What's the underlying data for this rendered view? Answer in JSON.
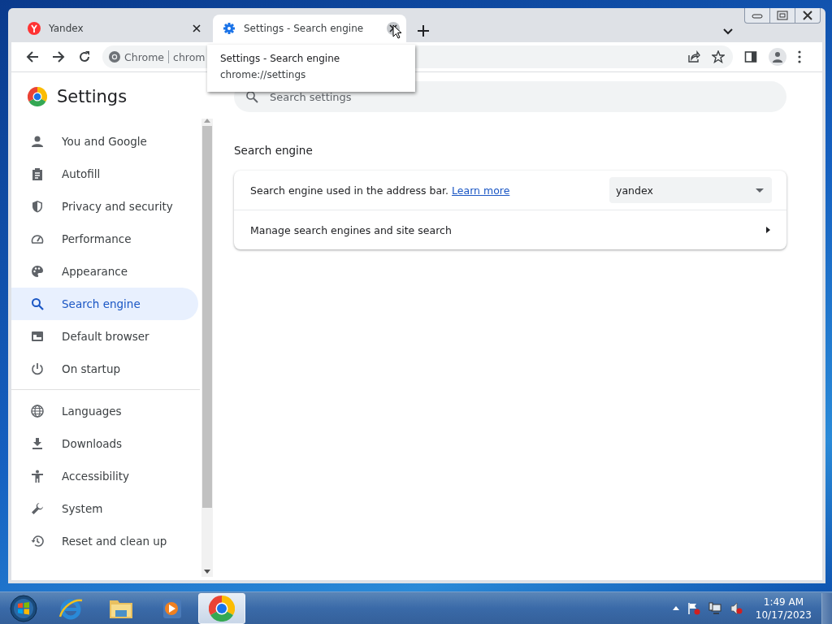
{
  "tabs": [
    {
      "title": "Yandex",
      "selected": false
    },
    {
      "title": "Settings - Search engine",
      "selected": true
    }
  ],
  "tooltip": {
    "title": "Settings - Search engine",
    "url": "chrome://settings"
  },
  "address_bar": {
    "chip": "Chrome",
    "text": "chrom"
  },
  "settings": {
    "title": "Settings",
    "search": {
      "placeholder": "Search settings"
    }
  },
  "sidebar": {
    "groups": [
      [
        {
          "label": "You and Google",
          "selected": false
        },
        {
          "label": "Autofill",
          "selected": false
        },
        {
          "label": "Privacy and security",
          "selected": false
        },
        {
          "label": "Performance",
          "selected": false
        },
        {
          "label": "Appearance",
          "selected": false
        },
        {
          "label": "Search engine",
          "selected": true
        },
        {
          "label": "Default browser",
          "selected": false
        },
        {
          "label": "On startup",
          "selected": false
        }
      ],
      [
        {
          "label": "Languages",
          "selected": false
        },
        {
          "label": "Downloads",
          "selected": false
        },
        {
          "label": "Accessibility",
          "selected": false
        },
        {
          "label": "System",
          "selected": false
        },
        {
          "label": "Reset and clean up",
          "selected": false
        }
      ]
    ]
  },
  "section": {
    "title": "Search engine",
    "rows": [
      {
        "kind": "select",
        "text": "Search engine used in the address bar.",
        "link": "Learn more",
        "value": "yandex"
      },
      {
        "kind": "nav",
        "text": "Manage search engines and site search"
      }
    ]
  },
  "taskbar": {
    "apps": [
      {
        "selected": false
      },
      {
        "selected": false
      },
      {
        "selected": false
      },
      {
        "selected": true
      }
    ],
    "clock": {
      "time": "1:49 AM",
      "date": "10/17/2023"
    }
  }
}
